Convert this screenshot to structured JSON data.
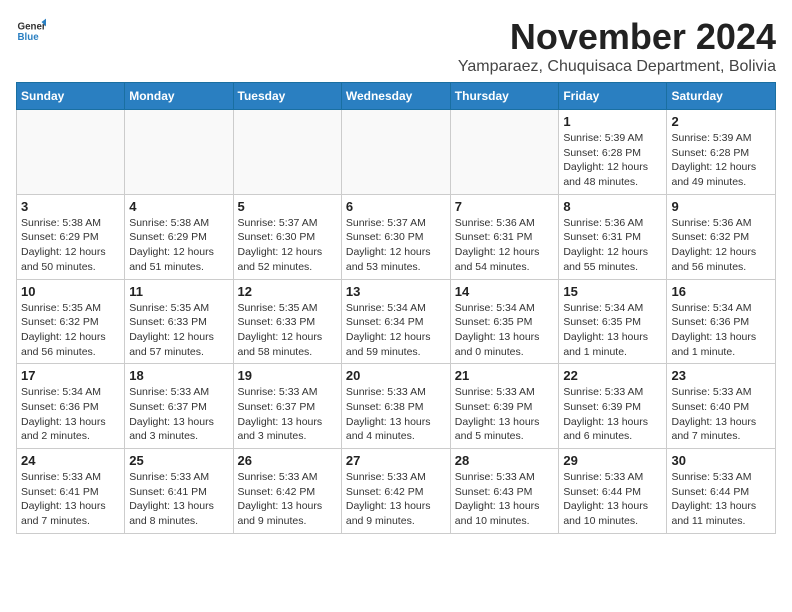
{
  "logo": {
    "general": "General",
    "blue": "Blue"
  },
  "header": {
    "month": "November 2024",
    "location": "Yamparaez, Chuquisaca Department, Bolivia"
  },
  "weekdays": [
    "Sunday",
    "Monday",
    "Tuesday",
    "Wednesday",
    "Thursday",
    "Friday",
    "Saturday"
  ],
  "weeks": [
    [
      {
        "day": "",
        "info": ""
      },
      {
        "day": "",
        "info": ""
      },
      {
        "day": "",
        "info": ""
      },
      {
        "day": "",
        "info": ""
      },
      {
        "day": "",
        "info": ""
      },
      {
        "day": "1",
        "info": "Sunrise: 5:39 AM\nSunset: 6:28 PM\nDaylight: 12 hours and 48 minutes."
      },
      {
        "day": "2",
        "info": "Sunrise: 5:39 AM\nSunset: 6:28 PM\nDaylight: 12 hours and 49 minutes."
      }
    ],
    [
      {
        "day": "3",
        "info": "Sunrise: 5:38 AM\nSunset: 6:29 PM\nDaylight: 12 hours and 50 minutes."
      },
      {
        "day": "4",
        "info": "Sunrise: 5:38 AM\nSunset: 6:29 PM\nDaylight: 12 hours and 51 minutes."
      },
      {
        "day": "5",
        "info": "Sunrise: 5:37 AM\nSunset: 6:30 PM\nDaylight: 12 hours and 52 minutes."
      },
      {
        "day": "6",
        "info": "Sunrise: 5:37 AM\nSunset: 6:30 PM\nDaylight: 12 hours and 53 minutes."
      },
      {
        "day": "7",
        "info": "Sunrise: 5:36 AM\nSunset: 6:31 PM\nDaylight: 12 hours and 54 minutes."
      },
      {
        "day": "8",
        "info": "Sunrise: 5:36 AM\nSunset: 6:31 PM\nDaylight: 12 hours and 55 minutes."
      },
      {
        "day": "9",
        "info": "Sunrise: 5:36 AM\nSunset: 6:32 PM\nDaylight: 12 hours and 56 minutes."
      }
    ],
    [
      {
        "day": "10",
        "info": "Sunrise: 5:35 AM\nSunset: 6:32 PM\nDaylight: 12 hours and 56 minutes."
      },
      {
        "day": "11",
        "info": "Sunrise: 5:35 AM\nSunset: 6:33 PM\nDaylight: 12 hours and 57 minutes."
      },
      {
        "day": "12",
        "info": "Sunrise: 5:35 AM\nSunset: 6:33 PM\nDaylight: 12 hours and 58 minutes."
      },
      {
        "day": "13",
        "info": "Sunrise: 5:34 AM\nSunset: 6:34 PM\nDaylight: 12 hours and 59 minutes."
      },
      {
        "day": "14",
        "info": "Sunrise: 5:34 AM\nSunset: 6:35 PM\nDaylight: 13 hours and 0 minutes."
      },
      {
        "day": "15",
        "info": "Sunrise: 5:34 AM\nSunset: 6:35 PM\nDaylight: 13 hours and 1 minute."
      },
      {
        "day": "16",
        "info": "Sunrise: 5:34 AM\nSunset: 6:36 PM\nDaylight: 13 hours and 1 minute."
      }
    ],
    [
      {
        "day": "17",
        "info": "Sunrise: 5:34 AM\nSunset: 6:36 PM\nDaylight: 13 hours and 2 minutes."
      },
      {
        "day": "18",
        "info": "Sunrise: 5:33 AM\nSunset: 6:37 PM\nDaylight: 13 hours and 3 minutes."
      },
      {
        "day": "19",
        "info": "Sunrise: 5:33 AM\nSunset: 6:37 PM\nDaylight: 13 hours and 3 minutes."
      },
      {
        "day": "20",
        "info": "Sunrise: 5:33 AM\nSunset: 6:38 PM\nDaylight: 13 hours and 4 minutes."
      },
      {
        "day": "21",
        "info": "Sunrise: 5:33 AM\nSunset: 6:39 PM\nDaylight: 13 hours and 5 minutes."
      },
      {
        "day": "22",
        "info": "Sunrise: 5:33 AM\nSunset: 6:39 PM\nDaylight: 13 hours and 6 minutes."
      },
      {
        "day": "23",
        "info": "Sunrise: 5:33 AM\nSunset: 6:40 PM\nDaylight: 13 hours and 7 minutes."
      }
    ],
    [
      {
        "day": "24",
        "info": "Sunrise: 5:33 AM\nSunset: 6:41 PM\nDaylight: 13 hours and 7 minutes."
      },
      {
        "day": "25",
        "info": "Sunrise: 5:33 AM\nSunset: 6:41 PM\nDaylight: 13 hours and 8 minutes."
      },
      {
        "day": "26",
        "info": "Sunrise: 5:33 AM\nSunset: 6:42 PM\nDaylight: 13 hours and 9 minutes."
      },
      {
        "day": "27",
        "info": "Sunrise: 5:33 AM\nSunset: 6:42 PM\nDaylight: 13 hours and 9 minutes."
      },
      {
        "day": "28",
        "info": "Sunrise: 5:33 AM\nSunset: 6:43 PM\nDaylight: 13 hours and 10 minutes."
      },
      {
        "day": "29",
        "info": "Sunrise: 5:33 AM\nSunset: 6:44 PM\nDaylight: 13 hours and 10 minutes."
      },
      {
        "day": "30",
        "info": "Sunrise: 5:33 AM\nSunset: 6:44 PM\nDaylight: 13 hours and 11 minutes."
      }
    ]
  ]
}
